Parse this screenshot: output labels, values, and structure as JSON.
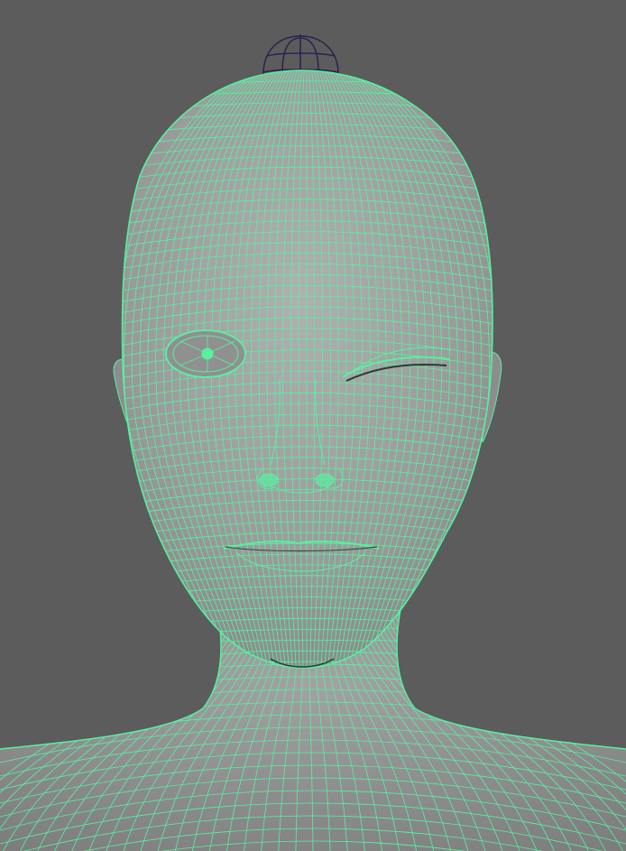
{
  "viewport": {
    "background_color": "#5c5c5c",
    "shaded_surface_color": "#9d9d9d",
    "wireframe_color": "#58f0a0",
    "control_color": "#2a2250"
  },
  "scene": {
    "object": "head-mesh",
    "display_mode": "wireframe-on-shaded",
    "selected": true
  }
}
